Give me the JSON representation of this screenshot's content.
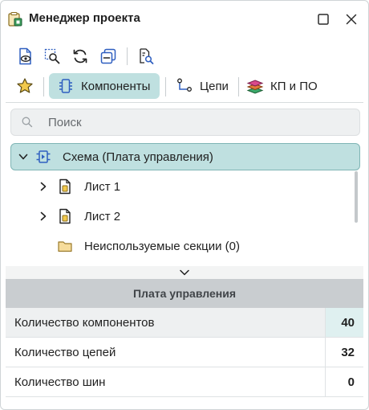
{
  "window": {
    "title": "Менеджер проекта"
  },
  "toolbar": {
    "buttons": [
      {
        "name": "view-document-icon"
      },
      {
        "name": "zoom-area-icon"
      },
      {
        "name": "refresh-icon"
      },
      {
        "name": "collapse-all-icon"
      },
      {
        "name": "find-in-document-icon"
      }
    ]
  },
  "tabs": [
    {
      "label": "Компоненты",
      "icon": "component-icon",
      "active": true
    },
    {
      "label": "Цепи",
      "icon": "net-icon",
      "active": false
    },
    {
      "label": "КП и ПО",
      "icon": "layers-icon",
      "active": false
    }
  ],
  "search": {
    "placeholder": "Поиск",
    "value": ""
  },
  "tree": {
    "root": {
      "label": "Схема (Плата управления)",
      "expanded": true
    },
    "children": [
      {
        "label": "Лист 1",
        "icon": "sheet-icon",
        "expandable": true
      },
      {
        "label": "Лист 2",
        "icon": "sheet-icon",
        "expandable": true
      },
      {
        "label": "Неиспользуемые секции (0)",
        "icon": "folder-icon",
        "expandable": false
      }
    ]
  },
  "properties": {
    "header": "Плата управления",
    "rows": [
      {
        "label": "Количество компонентов",
        "value": "40"
      },
      {
        "label": "Количество цепей",
        "value": "32"
      },
      {
        "label": "Количество шин",
        "value": "0"
      }
    ]
  },
  "colors": {
    "accent": "#bfe0e0",
    "accent_border": "#7fb5b5",
    "icon_blue": "#2f5fc0",
    "folder": "#e9c77b"
  }
}
